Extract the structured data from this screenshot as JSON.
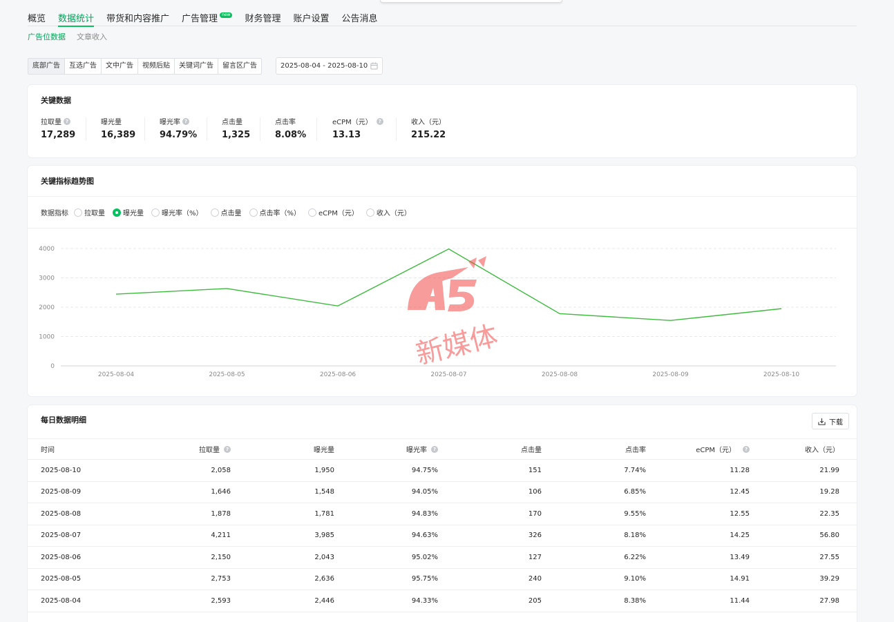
{
  "main_nav": [
    {
      "label": "概览",
      "active": false
    },
    {
      "label": "数据统计",
      "active": true
    },
    {
      "label": "带货和内容推广",
      "active": false
    },
    {
      "label": "广告管理",
      "active": false,
      "badge": "new"
    },
    {
      "label": "财务管理",
      "active": false
    },
    {
      "label": "账户设置",
      "active": false
    },
    {
      "label": "公告消息",
      "active": false
    }
  ],
  "sub_nav": [
    {
      "label": "广告位数据",
      "active": true
    },
    {
      "label": "文章收入",
      "active": false
    }
  ],
  "ad_types": [
    "底部广告",
    "互选广告",
    "文中广告",
    "视频后贴",
    "关键词广告",
    "留言区广告"
  ],
  "date_range": "2025-08-04 - 2025-08-10",
  "key_data": {
    "title": "关键数据",
    "metrics": [
      {
        "label": "拉取量",
        "value": "17,289",
        "help": true
      },
      {
        "label": "曝光量",
        "value": "16,389",
        "help": false
      },
      {
        "label": "曝光率",
        "value": "94.79%",
        "help": true
      },
      {
        "label": "点击量",
        "value": "1,325",
        "help": false
      },
      {
        "label": "点击率",
        "value": "8.08%",
        "help": false
      },
      {
        "label": "eCPM（元）",
        "value": "13.13",
        "help": true
      },
      {
        "label": "收入（元）",
        "value": "215.22",
        "help": false
      }
    ]
  },
  "trend": {
    "title": "关键指标趋势图",
    "metric_label": "数据指标",
    "options": [
      {
        "label": "拉取量",
        "checked": false
      },
      {
        "label": "曝光量",
        "checked": true
      },
      {
        "label": "曝光率（%）",
        "checked": false
      },
      {
        "label": "点击量",
        "checked": false
      },
      {
        "label": "点击率（%）",
        "checked": false
      },
      {
        "label": "eCPM（元）",
        "checked": false
      },
      {
        "label": "收入（元）",
        "checked": false
      }
    ]
  },
  "chart_data": {
    "type": "line",
    "x": [
      "2025-08-04",
      "2025-08-05",
      "2025-08-06",
      "2025-08-07",
      "2025-08-08",
      "2025-08-09",
      "2025-08-10"
    ],
    "series": [
      {
        "values": [
          2446,
          2636,
          2043,
          3985,
          1781,
          1548,
          1950
        ],
        "color": "#3dbb3d"
      }
    ],
    "yticks": [
      0,
      1000,
      2000,
      3000,
      4000
    ],
    "ylim": [
      0,
      4000
    ],
    "grid": true
  },
  "watermark": {
    "logo": "A5",
    "text": "新媒体"
  },
  "daily": {
    "title": "每日数据明细",
    "download_label": "下载",
    "headers": [
      {
        "label": "时间",
        "help": false
      },
      {
        "label": "拉取量",
        "help": true
      },
      {
        "label": "曝光量",
        "help": false
      },
      {
        "label": "曝光率",
        "help": true
      },
      {
        "label": "点击量",
        "help": false
      },
      {
        "label": "点击率",
        "help": false
      },
      {
        "label": "eCPM（元）",
        "help": true
      },
      {
        "label": "收入（元）",
        "help": false
      }
    ],
    "rows": [
      [
        "2025-08-10",
        "2,058",
        "1,950",
        "94.75%",
        "151",
        "7.74%",
        "11.28",
        "21.99"
      ],
      [
        "2025-08-09",
        "1,646",
        "1,548",
        "94.05%",
        "106",
        "6.85%",
        "12.45",
        "19.28"
      ],
      [
        "2025-08-08",
        "1,878",
        "1,781",
        "94.83%",
        "170",
        "9.55%",
        "12.55",
        "22.35"
      ],
      [
        "2025-08-07",
        "4,211",
        "3,985",
        "94.63%",
        "326",
        "8.18%",
        "14.25",
        "56.80"
      ],
      [
        "2025-08-06",
        "2,150",
        "2,043",
        "95.02%",
        "127",
        "6.22%",
        "13.49",
        "27.55"
      ],
      [
        "2025-08-05",
        "2,753",
        "2,636",
        "95.75%",
        "240",
        "9.10%",
        "14.91",
        "39.29"
      ],
      [
        "2025-08-04",
        "2,593",
        "2,446",
        "94.33%",
        "205",
        "8.38%",
        "11.44",
        "27.98"
      ]
    ]
  }
}
